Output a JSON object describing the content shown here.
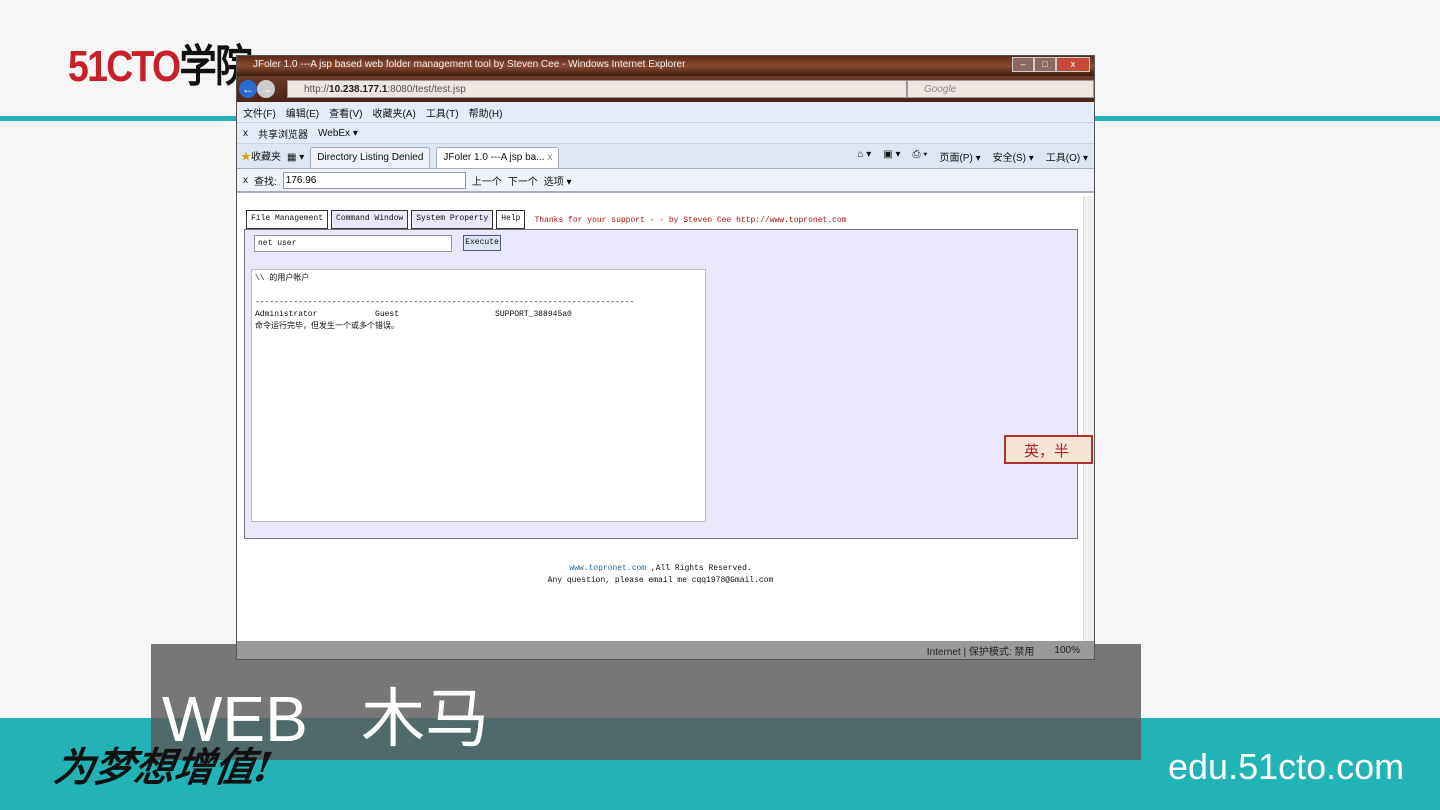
{
  "slide": {
    "logo_red": "51CTO",
    "logo_black": "学院",
    "title": "WEB   木马",
    "slogan": "为梦想增值!",
    "site": "edu.51cto.com",
    "stamp": "英，半"
  },
  "browser": {
    "title": "JFoler 1.0 ---A jsp based web folder management tool by Steven Cee - Windows Internet Explorer",
    "window_buttons": [
      "–",
      "□",
      "x"
    ],
    "url_prefix": "http://",
    "url_host": "10.238.177.1",
    "url_rest": ":8080/test/test.jsp",
    "search_placeholder": "Google",
    "menu": [
      "文件(F)",
      "编辑(E)",
      "查看(V)",
      "收藏夹(A)",
      "工具(T)",
      "帮助(H)"
    ],
    "toolbar": {
      "close": "x",
      "share": "共享浏览器",
      "webex": "WebEx ▾"
    },
    "favorites": "收藏夹",
    "tabs": [
      "Directory Listing Denied",
      "JFoler 1.0 ---A jsp ba..."
    ],
    "tab_close": "x",
    "right_tools": [
      "页面(P) ▾",
      "安全(S) ▾",
      "工具(O) ▾"
    ],
    "find": {
      "close": "x",
      "label": "查找:",
      "value": "176.96",
      "prev": "上一个",
      "next": "下一个",
      "options": "选项 ▾"
    },
    "status": {
      "zone": "Internet | 保护模式: 禁用",
      "zoom": "100%"
    }
  },
  "page": {
    "tabs": [
      "File Management",
      "Command Window",
      "System Property",
      "Help"
    ],
    "thanks": "Thanks for your support - - by Steven Cee http://www.topronet.com",
    "command": "net user",
    "execute": "Execute",
    "output": "\\\\ 的用户帐户\n\n-------------------------------------------------------------------------------\nAdministrator            Guest                    SUPPORT_388945a0\n命令运行完毕，但发生一个或多个错误。",
    "footer_link": "www.topronet.com",
    "footer_rights": " ,All Rights Reserved.",
    "footer_contact": "Any question, please email me cqq1978@Gmail.com"
  }
}
